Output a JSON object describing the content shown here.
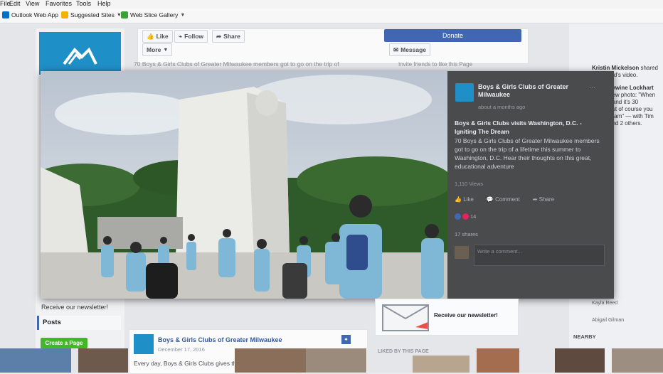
{
  "menubar": {
    "items": [
      "File",
      "Edit",
      "View",
      "Favorites",
      "Tools",
      "Help"
    ]
  },
  "favorites": [
    {
      "label": "Outlook Web App",
      "icon": "outlook-icon",
      "color": "#0072c6"
    },
    {
      "label": "Suggested Sites",
      "icon": "suggested-sites-icon",
      "color": "#f2b400"
    },
    {
      "label": "Web Slice Gallery",
      "icon": "web-slice-icon",
      "color": "#3aa03a"
    }
  ],
  "actions": {
    "like": "Like",
    "follow": "Follow",
    "share": "Share",
    "more": "More",
    "donate": "Donate",
    "message": "Message"
  },
  "about_text": "70 Boys & Girls Clubs of Greater Milwaukee members got to go on the trip of",
  "invite_text": "Invite friends to like this Page",
  "right_column": {
    "notif_name": "Kristin Mickelson",
    "notif_action": "shared",
    "notif_line2": "ood's video.",
    "notif2_line1": "llywine Lockhart",
    "notif2_lines": [
      "new photo: \"When",
      "r and it's 30",
      "out of course you",
      "ream\" — with Tim",
      "and 2 others."
    ]
  },
  "video_panel": {
    "page_name": "Boys & Girls Clubs of Greater Milwaukee",
    "time": "about a months ago",
    "heading": "Boys & Girls Clubs visits Washington, D.C. - Igniting The Dream",
    "body": "70 Boys & Girls Clubs of Greater Milwaukee members got to go on the trip of a lifetime this summer to Washington, D.C. Hear their thoughts on this great, educational adventure",
    "views": "1,110 Views",
    "like": "Like",
    "comment": "Comment",
    "share": "Share",
    "reactions": "14",
    "shares": "17 shares",
    "comment_placeholder": "Write a comment..."
  },
  "left_nav": {
    "newsletter": "Receive our newsletter!",
    "posts": "Posts",
    "create_page": "Create a Page"
  },
  "post": {
    "name": "Boys & Girls Clubs of Greater Milwaukee",
    "date": "December 17, 2016",
    "body": "Every day, Boys & Girls Clubs gives the gift of confidence, love,"
  },
  "newsletter_card": {
    "label": "Receive our newsletter!"
  },
  "liked_by": "LIKED BY THIS PAGE",
  "nearby": "NEARBY",
  "right_names": [
    "Kayla Reed",
    "Abigail Gilman"
  ],
  "colors": {
    "fb_blue": "#4267b2",
    "brand": "#1f8fc7",
    "green": "#42b72a"
  }
}
